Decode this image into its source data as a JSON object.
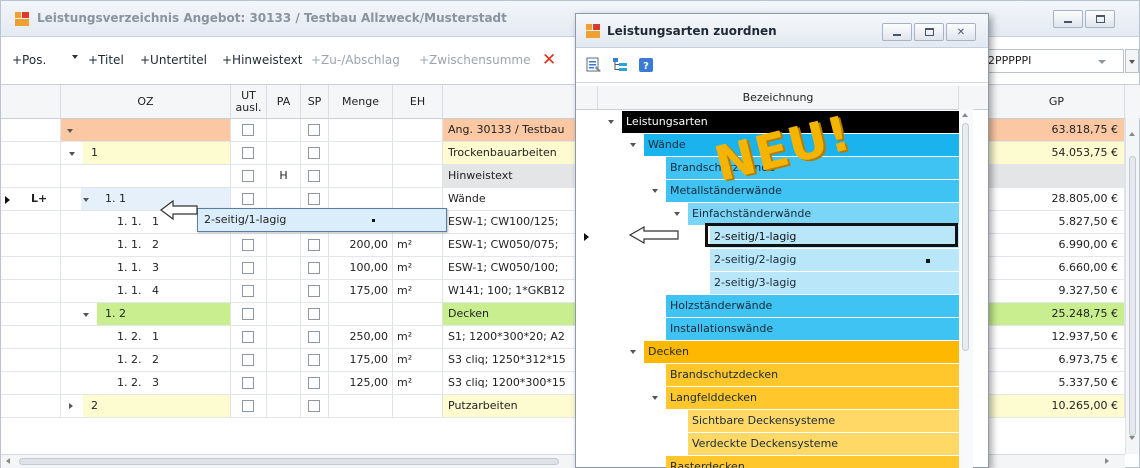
{
  "main": {
    "title": "Leistungsverzeichnis Angebot: 30133 / Testbau Allzweck/Musterstadt",
    "toolbar": {
      "pos": "+Pos.",
      "titel": "+Titel",
      "untertitel": "+Untertitel",
      "hinweistext": "+Hinweistext",
      "zuabschlag": "+Zu-/Abschlag",
      "zwischensumme": "+Zwischensumme",
      "delete_icon": "close-x-icon"
    },
    "combo_value": "2PPPPPI",
    "columns": {
      "oz": "OZ",
      "ut": "UT ausl.",
      "pa": "PA",
      "sp": "SP",
      "menge": "Menge",
      "eh": "EH",
      "gp": "GP"
    },
    "rows": [
      {
        "oz": "",
        "pa": "",
        "menge": "",
        "eh": "",
        "text": "Ang. 30133 / Testbau",
        "gp": "63.818,75 €"
      },
      {
        "oz": "1",
        "pa": "",
        "menge": "",
        "eh": "",
        "text": "Trockenbauarbeiten",
        "gp": "54.053,75 €"
      },
      {
        "oz": "",
        "pa": "H",
        "menge": "",
        "eh": "",
        "text": "Hinweistext",
        "gp": ""
      },
      {
        "oz": "1. 1",
        "pa": "",
        "menge": "",
        "eh": "",
        "text": "Wände",
        "gp": "28.805,00 €",
        "marker": "L+"
      },
      {
        "oz": "1. 1.   1",
        "pa": "",
        "menge": "150,00",
        "eh": "m²",
        "text": "ESW-1; CW100/125;",
        "gp": "5.827,50 €"
      },
      {
        "oz": "1. 1.   2",
        "pa": "",
        "menge": "200,00",
        "eh": "m²",
        "text": "ESW-1; CW050/075;",
        "gp": "6.990,00 €"
      },
      {
        "oz": "1. 1.   3",
        "pa": "",
        "menge": "100,00",
        "eh": "m²",
        "text": "ESW-1; CW050/100;",
        "gp": "6.660,00 €"
      },
      {
        "oz": "1. 1.   4",
        "pa": "",
        "menge": "175,00",
        "eh": "m²",
        "text": "W141; 100; 1*GKB12",
        "gp": "9.327,50 €"
      },
      {
        "oz": "1. 2",
        "pa": "",
        "menge": "",
        "eh": "",
        "text": "Decken",
        "gp": "25.248,75 €"
      },
      {
        "oz": "1. 2.   1",
        "pa": "",
        "menge": "250,00",
        "eh": "m²",
        "text": "S1; 1200*300*20; A2",
        "gp": "12.937,50 €"
      },
      {
        "oz": "1. 2.   2",
        "pa": "",
        "menge": "175,00",
        "eh": "m²",
        "text": "S3 cliq; 1250*312*15",
        "gp": "6.973,75 €"
      },
      {
        "oz": "1. 2.   3",
        "pa": "",
        "menge": "125,00",
        "eh": "m²",
        "text": "S3 cliq; 1200*300*15",
        "gp": "5.337,50 €"
      },
      {
        "oz": "2",
        "pa": "",
        "menge": "",
        "eh": "",
        "text": "Putzarbeiten",
        "gp": "10.265,00 €"
      }
    ],
    "popup_text": "2-seitig/1-lagig"
  },
  "dialog": {
    "title": "Leistungsarten zuordnen",
    "column_header": "Bezeichnung",
    "overlay_text": "NEU!",
    "tree": [
      {
        "label": "Leistungsarten",
        "color": "#000000",
        "text_color": "#ffffff"
      },
      {
        "label": "Wände",
        "color": "#1ab3ee",
        "text_color": "#1a2a3a"
      },
      {
        "label": "Brandschutzwände",
        "color": "#3fc3f2",
        "text_color": "#1a2a3a"
      },
      {
        "label": "Metallständerwände",
        "color": "#3fc3f2",
        "text_color": "#1a2a3a"
      },
      {
        "label": "Einfachständerwände",
        "color": "#7ad5f6",
        "text_color": "#1a2a3a"
      },
      {
        "label": "2-seitig/1-lagig",
        "color": "#b9e7f9",
        "text_color": "#111111"
      },
      {
        "label": "2-seitig/2-lagig",
        "color": "#b9e7f9",
        "text_color": "#1a2a3a"
      },
      {
        "label": "2-seitig/3-lagig",
        "color": "#b9e7f9",
        "text_color": "#1a2a3a"
      },
      {
        "label": "Holzständerwände",
        "color": "#3fc3f2",
        "text_color": "#1a2a3a"
      },
      {
        "label": "Installationswände",
        "color": "#3fc3f2",
        "text_color": "#1a2a3a"
      },
      {
        "label": "Decken",
        "color": "#ffb800",
        "text_color": "#1a2a3a"
      },
      {
        "label": "Brandschutzdecken",
        "color": "#ffc72c",
        "text_color": "#1a2a3a"
      },
      {
        "label": "Langfelddecken",
        "color": "#ffc72c",
        "text_color": "#1a2a3a"
      },
      {
        "label": "Sichtbare Deckensysteme",
        "color": "#ffd866",
        "text_color": "#1a2a3a"
      },
      {
        "label": "Verdeckte Deckensysteme",
        "color": "#ffd866",
        "text_color": "#1a2a3a"
      },
      {
        "label": "Rasterdecken",
        "color": "#ffc72c",
        "text_color": "#1a2a3a"
      }
    ]
  },
  "colors": {
    "root_row": "#fbc8a3",
    "title_row": "#fdfbd0",
    "subtitle_row": "#c8ee8f",
    "hint_row": "#e4e5e7",
    "selected_popup": "#d9eefa",
    "blue_group": "#1ab3ee",
    "orange_group": "#ffb800"
  }
}
